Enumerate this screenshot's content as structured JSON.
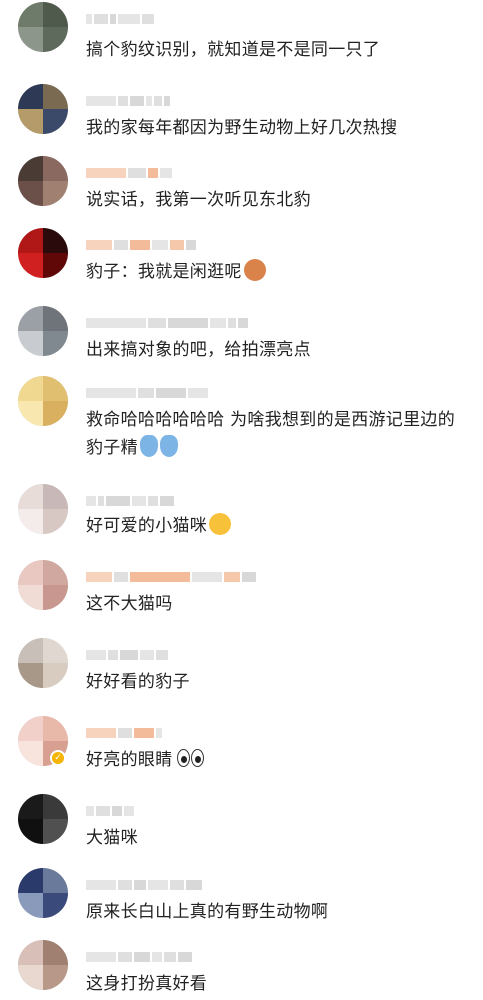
{
  "comments": [
    {
      "text": "搞个豹纹识别，就知道是不是同一只了",
      "emoji": "",
      "verified": false
    },
    {
      "text": "我的家每年都因为野生动物上好几次热搜",
      "emoji": "",
      "verified": false
    },
    {
      "text": "说实话，我第一次听见东北豹",
      "emoji": "",
      "verified": false
    },
    {
      "text": "豹子：我就是闲逛呢",
      "emoji": "leopard-emoji",
      "verified": false
    },
    {
      "text": "出来搞对象的吧，给拍漂亮点",
      "emoji": "",
      "verified": false
    },
    {
      "text": "救命哈哈哈哈哈哈 为啥我想到的是西游记里边的豹子精",
      "emoji": "crying-emoji",
      "verified": false
    },
    {
      "text": "好可爱的小猫咪",
      "emoji": "kiss-emoji",
      "verified": false
    },
    {
      "text": "这不大猫吗",
      "emoji": "",
      "verified": false
    },
    {
      "text": "好好看的豹子",
      "emoji": "",
      "verified": false
    },
    {
      "text": "好亮的眼睛",
      "emoji": "eyes-emoji",
      "verified": true
    },
    {
      "text": "大猫咪",
      "emoji": "",
      "verified": false
    },
    {
      "text": "原来长白山上真的有野生动物啊",
      "emoji": "",
      "verified": false
    },
    {
      "text": "这身打扮真好看",
      "emoji": "",
      "verified": false
    }
  ],
  "colors": {
    "text": "#222222",
    "username_blur": "#d4d4d4",
    "username_blur_orange": "#f2b48f",
    "verified_badge": "#f5b400"
  }
}
